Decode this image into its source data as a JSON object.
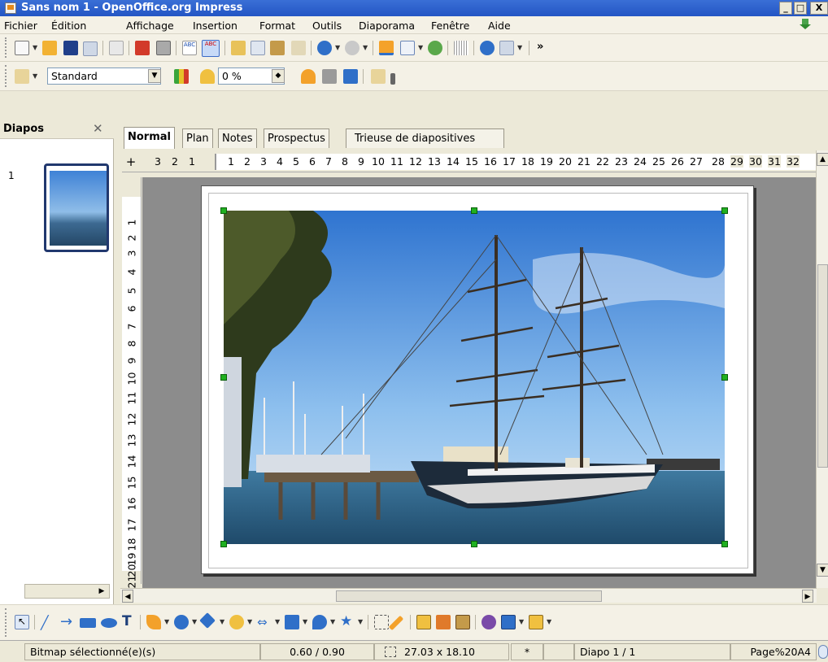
{
  "window": {
    "title": "Sans nom 1 - OpenOffice.org Impress",
    "minimize": "_",
    "maximize": "□",
    "close": "X"
  },
  "menu": [
    "Fichier",
    "Édition",
    "Affichage",
    "Insertion",
    "Format",
    "Outils",
    "Diaporama",
    "Fenêtre",
    "Aide"
  ],
  "toolbar2": {
    "style_value": "Standard",
    "percent_value": "0 %"
  },
  "slides_pane": {
    "title": "Diapos",
    "close": "✕",
    "slide_number": "1"
  },
  "tabs": [
    "Normal",
    "Plan",
    "Notes",
    "Prospectus",
    "Trieuse de diapositives"
  ],
  "ruler_h": {
    "corner": "+",
    "left": [
      "3",
      "2",
      "1"
    ],
    "main": [
      "1",
      "2",
      "3",
      "4",
      "5",
      "6",
      "7",
      "8",
      "9",
      "10",
      "11",
      "12",
      "13",
      "14",
      "15",
      "16",
      "17",
      "18",
      "19",
      "20",
      "21",
      "22",
      "23",
      "24",
      "25",
      "26",
      "27",
      "28",
      "29",
      "30",
      "31",
      "32"
    ]
  },
  "ruler_v": [
    "1",
    "2",
    "3",
    "4",
    "5",
    "6",
    "7",
    "8",
    "9",
    "10",
    "11",
    "12",
    "13",
    "14",
    "15",
    "16",
    "17",
    "18",
    "19",
    "20",
    "21"
  ],
  "status": {
    "selection": "Bitmap sélectionné(e)(s)",
    "position": "0.60 / 0.90",
    "size": "27.03 x 18.10",
    "modified": "*",
    "slide": "Diapo 1 / 1",
    "layout": "Page%20A4"
  },
  "colors": {
    "accent": "#2355c4",
    "handle": "#20b020",
    "sky": "#4f92de",
    "sea": "#2a5a7e"
  }
}
